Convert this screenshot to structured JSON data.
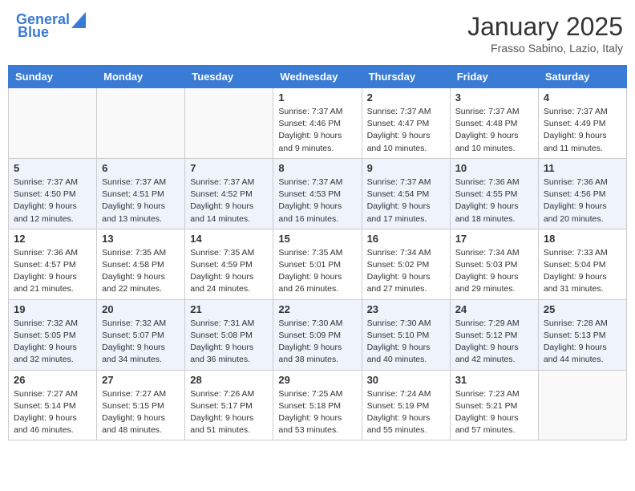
{
  "header": {
    "logo_line1": "General",
    "logo_line2": "Blue",
    "month": "January 2025",
    "location": "Frasso Sabino, Lazio, Italy"
  },
  "weekdays": [
    "Sunday",
    "Monday",
    "Tuesday",
    "Wednesday",
    "Thursday",
    "Friday",
    "Saturday"
  ],
  "weeks": [
    [
      {
        "day": "",
        "info": ""
      },
      {
        "day": "",
        "info": ""
      },
      {
        "day": "",
        "info": ""
      },
      {
        "day": "1",
        "info": "Sunrise: 7:37 AM\nSunset: 4:46 PM\nDaylight: 9 hours\nand 9 minutes."
      },
      {
        "day": "2",
        "info": "Sunrise: 7:37 AM\nSunset: 4:47 PM\nDaylight: 9 hours\nand 10 minutes."
      },
      {
        "day": "3",
        "info": "Sunrise: 7:37 AM\nSunset: 4:48 PM\nDaylight: 9 hours\nand 10 minutes."
      },
      {
        "day": "4",
        "info": "Sunrise: 7:37 AM\nSunset: 4:49 PM\nDaylight: 9 hours\nand 11 minutes."
      }
    ],
    [
      {
        "day": "5",
        "info": "Sunrise: 7:37 AM\nSunset: 4:50 PM\nDaylight: 9 hours\nand 12 minutes."
      },
      {
        "day": "6",
        "info": "Sunrise: 7:37 AM\nSunset: 4:51 PM\nDaylight: 9 hours\nand 13 minutes."
      },
      {
        "day": "7",
        "info": "Sunrise: 7:37 AM\nSunset: 4:52 PM\nDaylight: 9 hours\nand 14 minutes."
      },
      {
        "day": "8",
        "info": "Sunrise: 7:37 AM\nSunset: 4:53 PM\nDaylight: 9 hours\nand 16 minutes."
      },
      {
        "day": "9",
        "info": "Sunrise: 7:37 AM\nSunset: 4:54 PM\nDaylight: 9 hours\nand 17 minutes."
      },
      {
        "day": "10",
        "info": "Sunrise: 7:36 AM\nSunset: 4:55 PM\nDaylight: 9 hours\nand 18 minutes."
      },
      {
        "day": "11",
        "info": "Sunrise: 7:36 AM\nSunset: 4:56 PM\nDaylight: 9 hours\nand 20 minutes."
      }
    ],
    [
      {
        "day": "12",
        "info": "Sunrise: 7:36 AM\nSunset: 4:57 PM\nDaylight: 9 hours\nand 21 minutes."
      },
      {
        "day": "13",
        "info": "Sunrise: 7:35 AM\nSunset: 4:58 PM\nDaylight: 9 hours\nand 22 minutes."
      },
      {
        "day": "14",
        "info": "Sunrise: 7:35 AM\nSunset: 4:59 PM\nDaylight: 9 hours\nand 24 minutes."
      },
      {
        "day": "15",
        "info": "Sunrise: 7:35 AM\nSunset: 5:01 PM\nDaylight: 9 hours\nand 26 minutes."
      },
      {
        "day": "16",
        "info": "Sunrise: 7:34 AM\nSunset: 5:02 PM\nDaylight: 9 hours\nand 27 minutes."
      },
      {
        "day": "17",
        "info": "Sunrise: 7:34 AM\nSunset: 5:03 PM\nDaylight: 9 hours\nand 29 minutes."
      },
      {
        "day": "18",
        "info": "Sunrise: 7:33 AM\nSunset: 5:04 PM\nDaylight: 9 hours\nand 31 minutes."
      }
    ],
    [
      {
        "day": "19",
        "info": "Sunrise: 7:32 AM\nSunset: 5:05 PM\nDaylight: 9 hours\nand 32 minutes."
      },
      {
        "day": "20",
        "info": "Sunrise: 7:32 AM\nSunset: 5:07 PM\nDaylight: 9 hours\nand 34 minutes."
      },
      {
        "day": "21",
        "info": "Sunrise: 7:31 AM\nSunset: 5:08 PM\nDaylight: 9 hours\nand 36 minutes."
      },
      {
        "day": "22",
        "info": "Sunrise: 7:30 AM\nSunset: 5:09 PM\nDaylight: 9 hours\nand 38 minutes."
      },
      {
        "day": "23",
        "info": "Sunrise: 7:30 AM\nSunset: 5:10 PM\nDaylight: 9 hours\nand 40 minutes."
      },
      {
        "day": "24",
        "info": "Sunrise: 7:29 AM\nSunset: 5:12 PM\nDaylight: 9 hours\nand 42 minutes."
      },
      {
        "day": "25",
        "info": "Sunrise: 7:28 AM\nSunset: 5:13 PM\nDaylight: 9 hours\nand 44 minutes."
      }
    ],
    [
      {
        "day": "26",
        "info": "Sunrise: 7:27 AM\nSunset: 5:14 PM\nDaylight: 9 hours\nand 46 minutes."
      },
      {
        "day": "27",
        "info": "Sunrise: 7:27 AM\nSunset: 5:15 PM\nDaylight: 9 hours\nand 48 minutes."
      },
      {
        "day": "28",
        "info": "Sunrise: 7:26 AM\nSunset: 5:17 PM\nDaylight: 9 hours\nand 51 minutes."
      },
      {
        "day": "29",
        "info": "Sunrise: 7:25 AM\nSunset: 5:18 PM\nDaylight: 9 hours\nand 53 minutes."
      },
      {
        "day": "30",
        "info": "Sunrise: 7:24 AM\nSunset: 5:19 PM\nDaylight: 9 hours\nand 55 minutes."
      },
      {
        "day": "31",
        "info": "Sunrise: 7:23 AM\nSunset: 5:21 PM\nDaylight: 9 hours\nand 57 minutes."
      },
      {
        "day": "",
        "info": ""
      }
    ]
  ]
}
